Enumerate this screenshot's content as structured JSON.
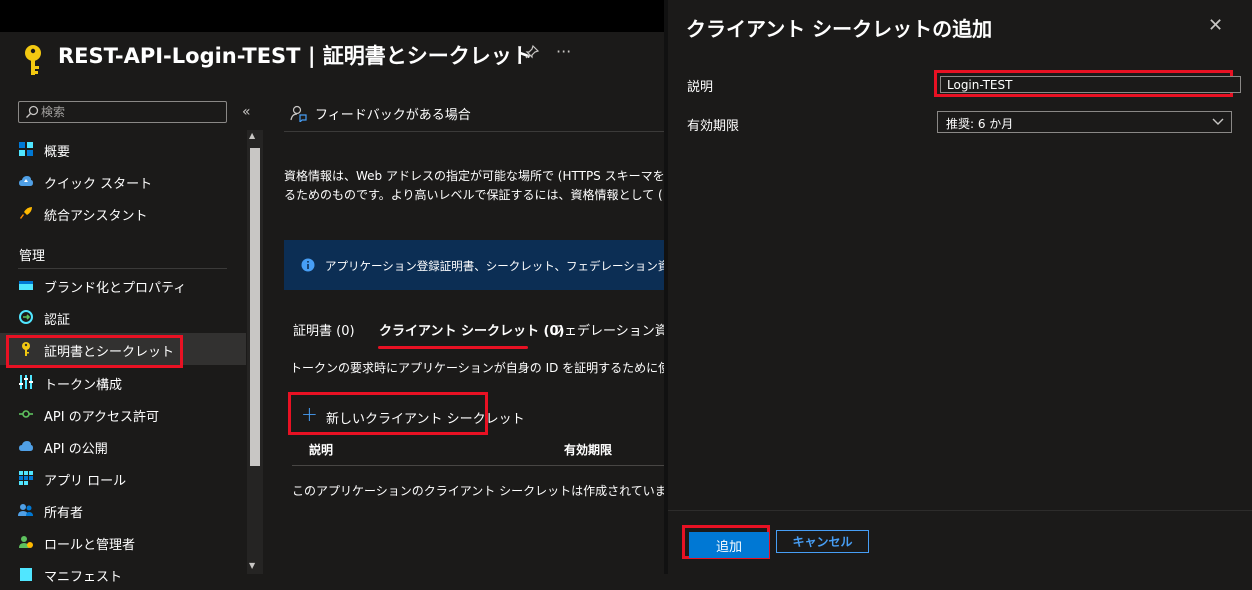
{
  "header": {
    "title": "REST-API-Login-TEST | 証明書とシークレット",
    "pin_icon": "pin-icon",
    "more_label": "···"
  },
  "sidebar": {
    "search_placeholder": "検索",
    "collapse_label": "«",
    "items_top": [
      {
        "label": "概要",
        "icon": "overview-grid-icon"
      },
      {
        "label": "クイック スタート",
        "icon": "cloud-quickstart-icon"
      },
      {
        "label": "統合アシスタント",
        "icon": "rocket-icon"
      }
    ],
    "section_label": "管理",
    "items_manage": [
      {
        "label": "ブランド化とプロパティ",
        "icon": "branding-icon"
      },
      {
        "label": "認証",
        "icon": "authentication-icon"
      },
      {
        "label": "証明書とシークレット",
        "icon": "key-icon",
        "selected": true
      },
      {
        "label": "トークン構成",
        "icon": "token-config-icon"
      },
      {
        "label": "API のアクセス許可",
        "icon": "api-permission-icon"
      },
      {
        "label": "API の公開",
        "icon": "cloud-api-icon"
      },
      {
        "label": "アプリ ロール",
        "icon": "app-roles-icon"
      },
      {
        "label": "所有者",
        "icon": "owners-icon"
      },
      {
        "label": "ロールと管理者",
        "icon": "roles-admins-icon"
      },
      {
        "label": "マニフェスト",
        "icon": "manifest-icon"
      }
    ]
  },
  "main": {
    "feedback_label": "フィードバックがある場合",
    "description_line1": "資格情報は、Web アドレスの指定が可能な場所で (HTTPS スキーマを使用",
    "description_line2": "るためのものです。より高いレベルで保証するには、資格情報として (クライアン",
    "info_text": "アプリケーション登録証明書、シークレット、フェデレーション資格情報は、下",
    "tabs": [
      {
        "label": "証明書 (0)"
      },
      {
        "label": "クライアント シークレット (0)",
        "active": true
      },
      {
        "label": "フェデレーション資格情"
      }
    ],
    "token_desc": "トークンの要求時にアプリケーションが自身の ID を証明するために使用する",
    "new_secret_label": "新しいクライアント シークレット",
    "table_headers": {
      "description": "説明",
      "expires": "有効期限"
    },
    "empty_message": "このアプリケーションのクライアント シークレットは作成されていません。"
  },
  "panel": {
    "title": "クライアント シークレットの追加",
    "close_label": "✕",
    "description_label": "説明",
    "description_value": "Login-TEST",
    "expires_label": "有効期限",
    "expires_value": "推奨: 6 か月",
    "add_label": "追加",
    "cancel_label": "キャンセル"
  },
  "colors": {
    "background": "#1b1a19",
    "accent": "#0078d4",
    "link": "#479ef5",
    "highlight_red": "#e81123",
    "info_bar": "#0c2e54"
  }
}
